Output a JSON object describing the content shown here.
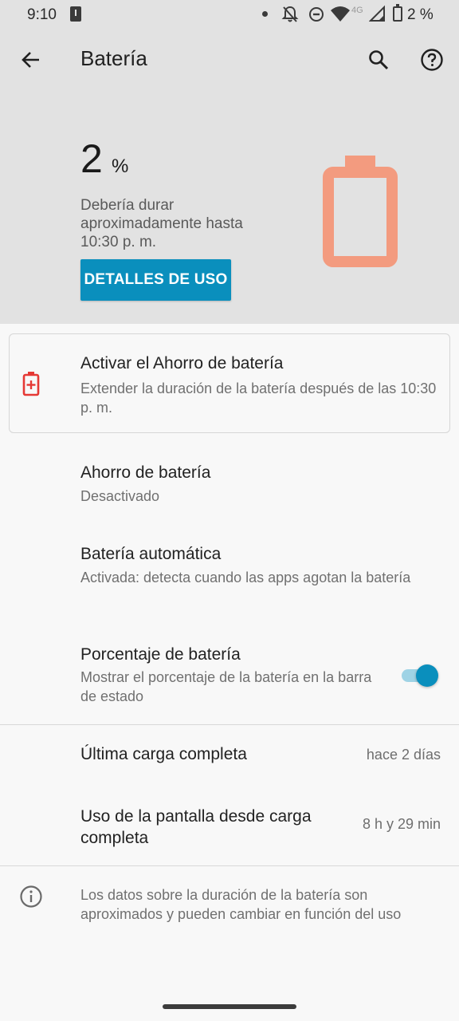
{
  "status_bar": {
    "time": "9:10",
    "network": "4G",
    "battery_text": "2 %"
  },
  "app_bar": {
    "title": "Batería",
    "icons": [
      "back-arrow-icon",
      "search-icon",
      "help-icon"
    ]
  },
  "hero": {
    "level": "2",
    "unit": "%",
    "estimate": "Debería durar aproximadamente hasta 10:30 p. m.",
    "usage_button": "DETALLES DE USO",
    "battery_color": "#f39b7f"
  },
  "suggestion": {
    "title": "Activar el Ahorro de batería",
    "subtitle": "Extender la duración de la batería después de las 10:30 p. m.",
    "icon_color": "#e53935"
  },
  "settings": {
    "saver": {
      "title": "Ahorro de batería",
      "subtitle": "Desactivado"
    },
    "adaptive": {
      "title": "Batería automática",
      "subtitle": "Activada: detecta cuando las apps agotan la batería"
    },
    "percentage": {
      "title": "Porcentaje de batería",
      "subtitle": "Mostrar el porcentaje de la batería en la barra de estado",
      "enabled": true
    }
  },
  "stats": {
    "last_charge": {
      "label": "Última carga completa",
      "value": "hace 2 días"
    },
    "screen_usage": {
      "label": "Uso de la pantalla desde carga completa",
      "value": "8 h y 29 min"
    }
  },
  "footer_info": "Los datos sobre la duración de la batería son aproximados y pueden cambiar en función del uso",
  "accent_color": "#0a8fbd"
}
